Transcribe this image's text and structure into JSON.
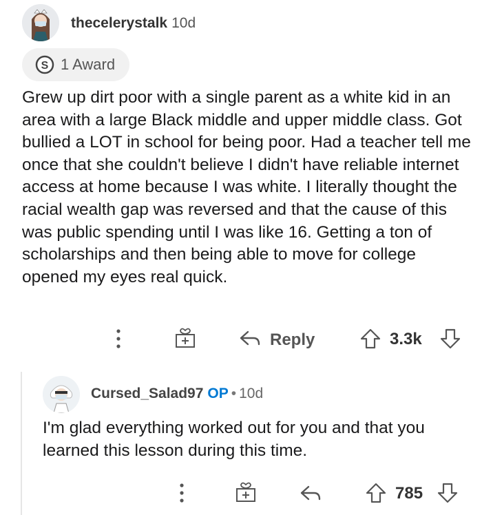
{
  "comment": {
    "username": "thecelerystalk",
    "age": "10d",
    "award_label": "1 Award",
    "body": "Grew up dirt poor with a single parent as a white kid in an area with a large Black middle and upper middle class. Got bullied a LOT in school for being poor. Had a teacher tell me once that she couldn't believe I didn't have reliable internet access at home because I was white. I literally thought the racial wealth gap was reversed and that the cause of this was public spending until I was like 16. Getting a ton of scholarships and then being able to move for college opened my eyes real quick.",
    "actions": {
      "reply_label": "Reply",
      "vote_count": "3.3k"
    }
  },
  "reply": {
    "username": "Cursed_Salad97",
    "op_badge": "OP",
    "separator": "•",
    "age": "10d",
    "body": "I'm glad everything worked out for you and that you learned this lesson during this time.",
    "actions": {
      "vote_count": "785"
    }
  },
  "icons": {
    "more": "more-options-icon",
    "gift": "gift-award-icon",
    "reply": "reply-arrow-icon",
    "upvote": "upvote-arrow-icon",
    "downvote": "downvote-arrow-icon"
  },
  "colors": {
    "op_badge": "#0079d3",
    "award_pill_bg": "#f1f1f1",
    "text": "#1a1a1b",
    "muted": "#555555"
  }
}
